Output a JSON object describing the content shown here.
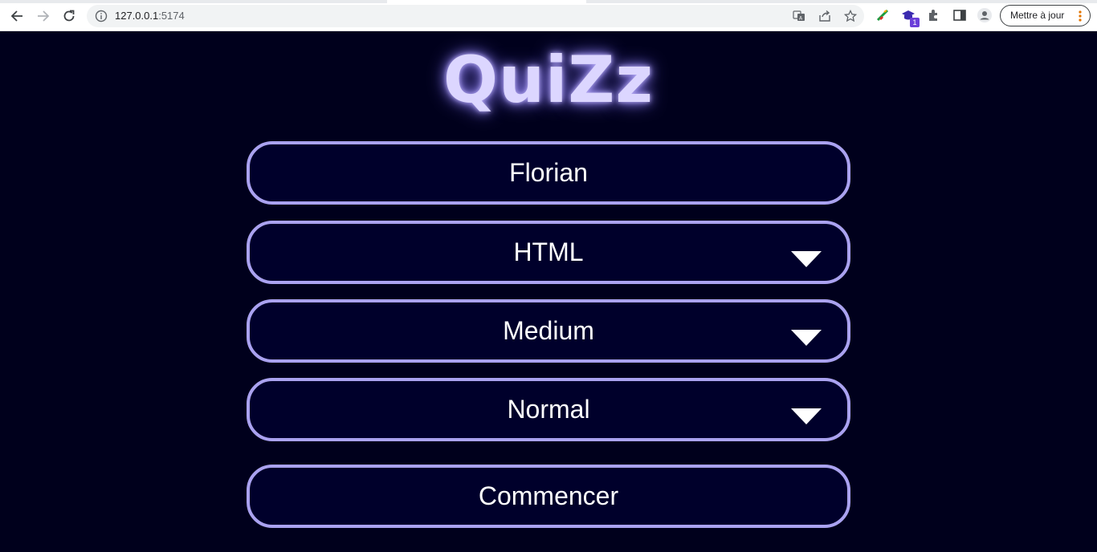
{
  "browser": {
    "url_host": "127.0.0.1",
    "url_port": ":5174",
    "update_label": "Mettre à jour",
    "extension_badge": "1"
  },
  "app": {
    "title": "QuiZz",
    "player_name": "Florian",
    "category": "HTML",
    "difficulty": "Medium",
    "mode": "Normal",
    "start_label": "Commencer"
  },
  "colors": {
    "background": "#00001c",
    "field_background": "#00002b",
    "field_border": "#aaa2f0",
    "title": "#dcd6ff"
  }
}
